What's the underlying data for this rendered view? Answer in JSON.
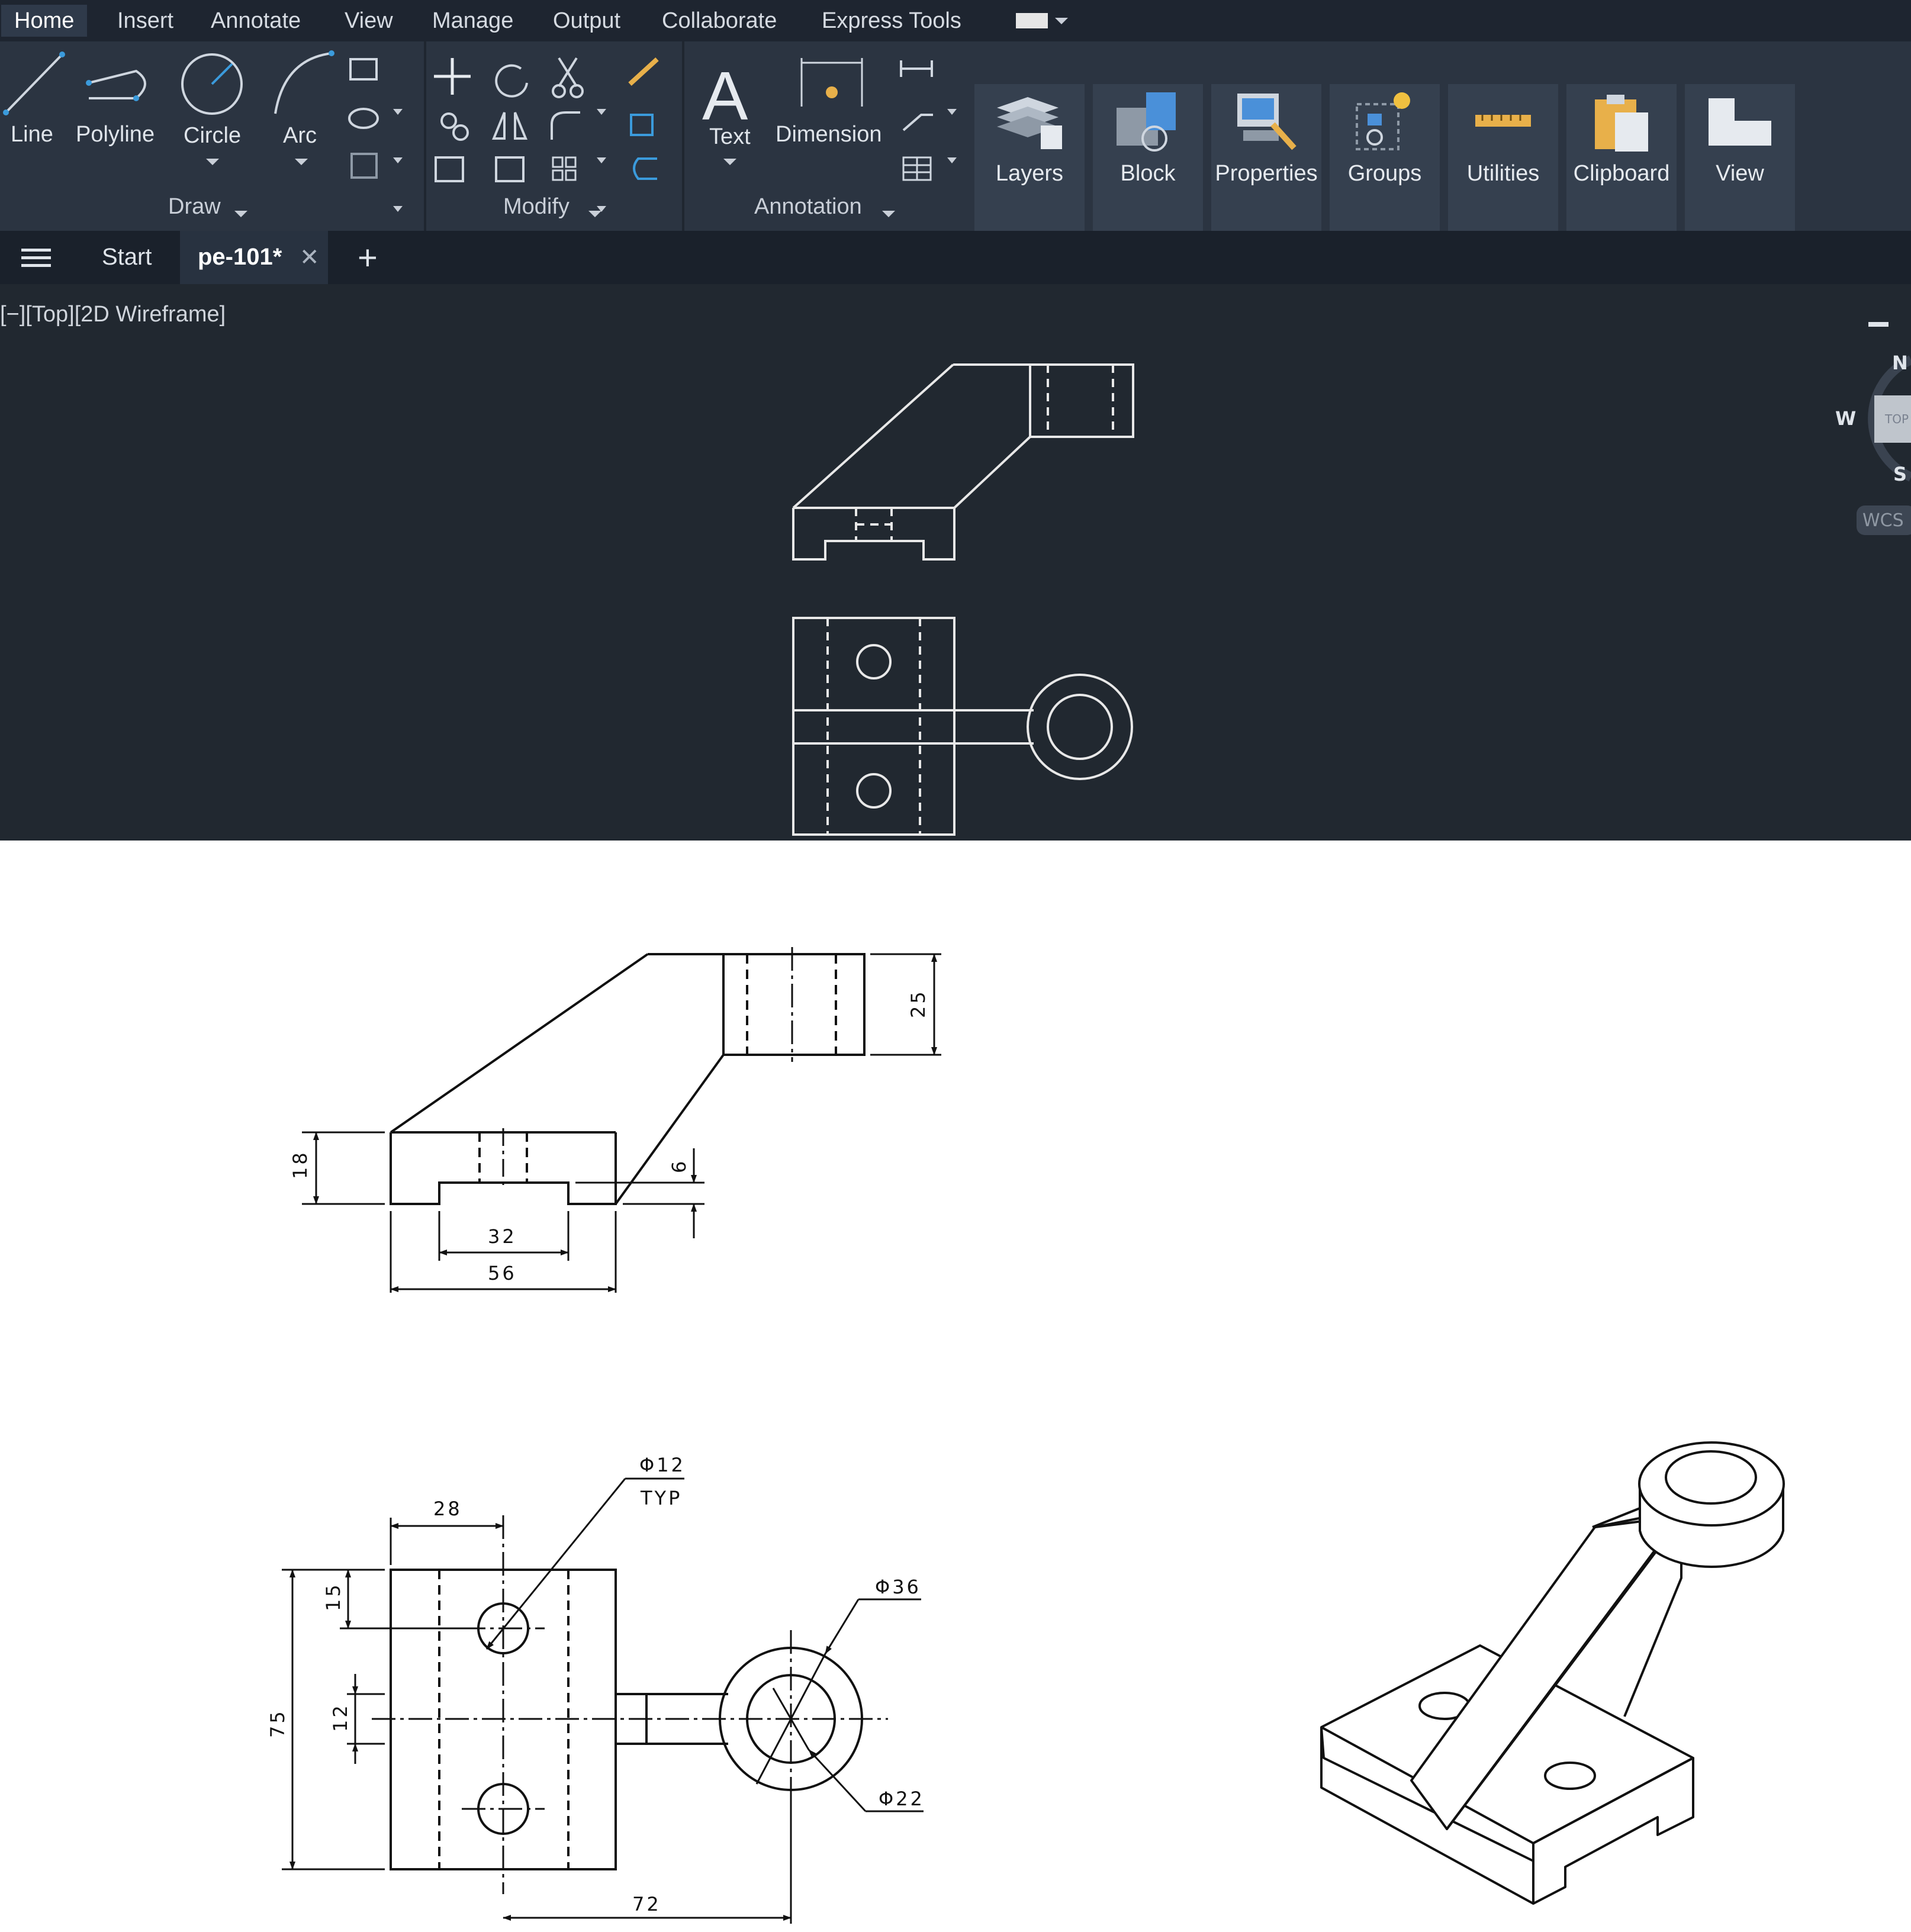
{
  "menubar": {
    "tabs": [
      "Home",
      "Insert",
      "Annotate",
      "View",
      "Manage",
      "Output",
      "Collaborate",
      "Express Tools"
    ]
  },
  "ribbon": {
    "draw": {
      "line": "Line",
      "polyline": "Polyline",
      "circle": "Circle",
      "arc": "Arc",
      "panel": "Draw"
    },
    "modify": {
      "panel": "Modify"
    },
    "annotation": {
      "text": "Text",
      "dimension": "Dimension",
      "panel": "Annotation"
    },
    "tiles": [
      "Layers",
      "Block",
      "Properties",
      "Groups",
      "Utilities",
      "Clipboard",
      "View"
    ]
  },
  "tabs": {
    "start": "Start",
    "file": "pe-101*"
  },
  "viewport": {
    "label": "[−][Top][2D Wireframe]",
    "compass": {
      "north": "N",
      "west": "W",
      "south": "S",
      "top": "TOP",
      "wcs": "WCS"
    }
  },
  "drawing": {
    "dims": {
      "d25": "25",
      "d18": "18",
      "d6": "6",
      "d32": "32",
      "d56": "56",
      "d28": "28",
      "d15": "15",
      "d75": "75",
      "d12": "12",
      "d72": "72",
      "hole": "Φ12",
      "typ": "TYP",
      "outer": "Φ36",
      "inner": "Φ22"
    }
  },
  "colors": {
    "app_bg": "#212830",
    "ribbon_bg": "#2b3441",
    "tile_bg": "#35404f",
    "wire": "#e8e8e8",
    "ink": "#111111"
  }
}
